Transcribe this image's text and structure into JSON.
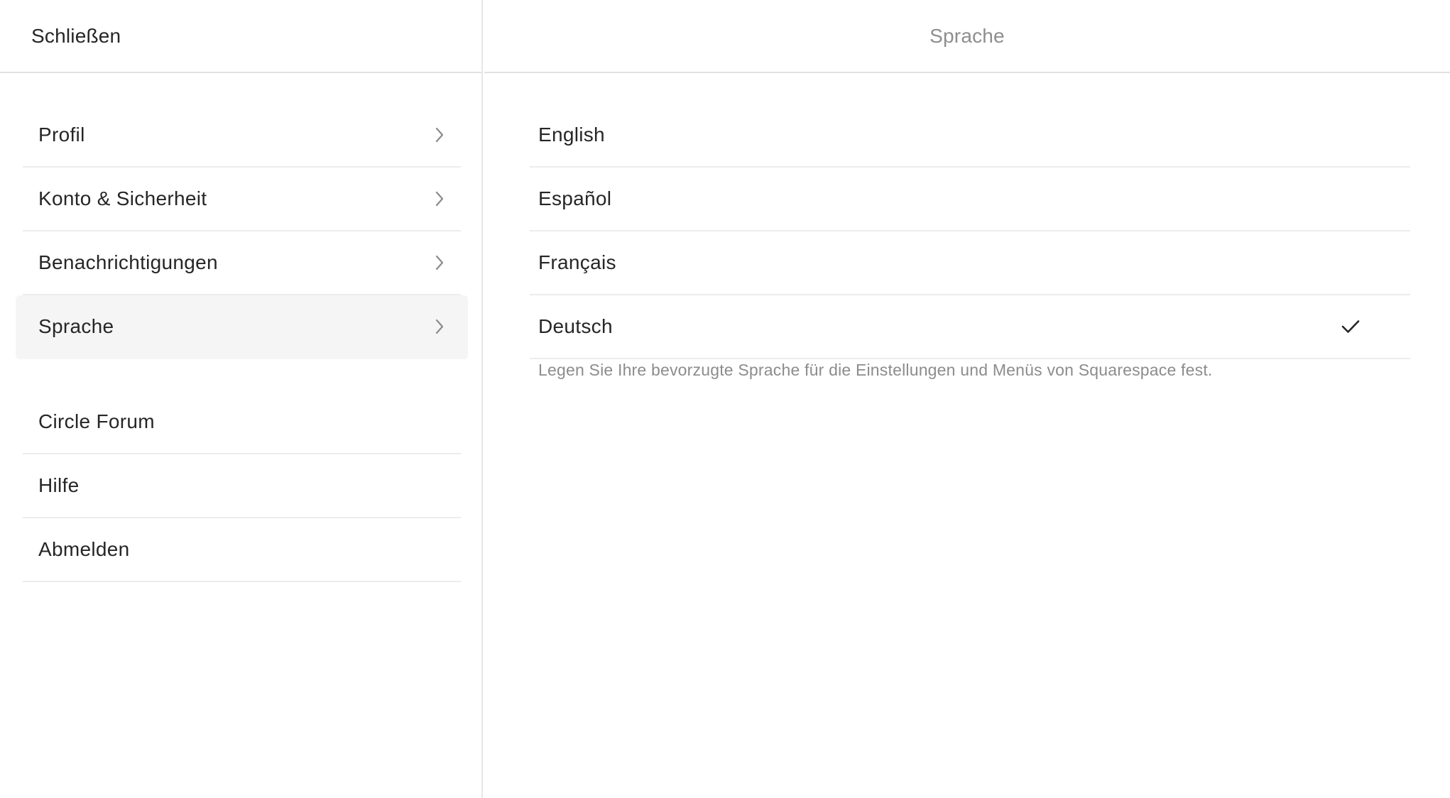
{
  "header": {
    "close_label": "Schließen",
    "panel_title": "Sprache"
  },
  "sidebar": {
    "items": [
      {
        "label": "Profil",
        "icon": "chevron-right-icon"
      },
      {
        "label": "Konto & Sicherheit",
        "icon": "chevron-right-icon"
      },
      {
        "label": "Benachrichtigungen",
        "icon": "chevron-right-icon"
      },
      {
        "label": "Sprache",
        "icon": "chevron-right-icon",
        "active": true
      }
    ],
    "secondary_items": [
      {
        "label": "Circle Forum"
      },
      {
        "label": "Hilfe"
      },
      {
        "label": "Abmelden"
      }
    ]
  },
  "languages": {
    "options": [
      {
        "label": "English"
      },
      {
        "label": "Español"
      },
      {
        "label": "Français"
      },
      {
        "label": "Deutsch",
        "selected": true,
        "icon": "checkmark-icon"
      }
    ],
    "hint": "Legen Sie Ihre bevorzugte Sprache für die Einstellungen und Menüs von Squarespace fest."
  },
  "colors": {
    "text": "#262626",
    "muted": "#8e8e8e",
    "divider": "#ececec",
    "active_bg": "#f5f5f5"
  }
}
